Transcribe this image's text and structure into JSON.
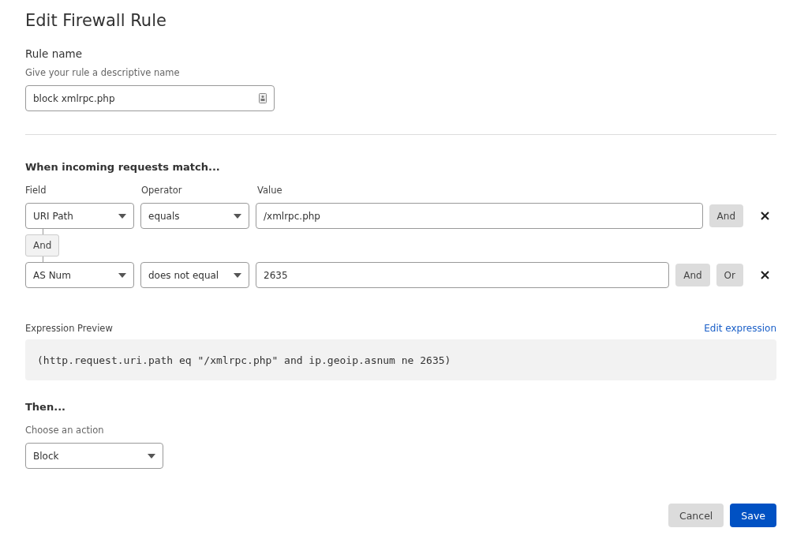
{
  "title": "Edit Firewall Rule",
  "rule_name": {
    "label": "Rule name",
    "hint": "Give your rule a descriptive name",
    "value": "block xmlrpc.php"
  },
  "conditions": {
    "heading": "When incoming requests match...",
    "columns": [
      "Field",
      "Operator",
      "Value"
    ],
    "rows": [
      {
        "joiner": null,
        "field": "URI Path",
        "operator": "equals",
        "value": "/xmlrpc.php",
        "buttons": [
          "And"
        ]
      },
      {
        "joiner": "And",
        "field": "AS Num",
        "operator": "does not equal",
        "value": "2635",
        "buttons": [
          "And",
          "Or"
        ]
      }
    ]
  },
  "expression": {
    "label": "Expression Preview",
    "link": "Edit expression",
    "code": "(http.request.uri.path eq \"/xmlrpc.php\" and ip.geoip.asnum ne 2635)"
  },
  "then": {
    "heading": "Then...",
    "hint": "Choose an action",
    "action": "Block"
  },
  "footer": [
    {
      "label": "Cancel",
      "kind": "secondary"
    },
    {
      "label": "Save",
      "kind": "primary"
    }
  ]
}
